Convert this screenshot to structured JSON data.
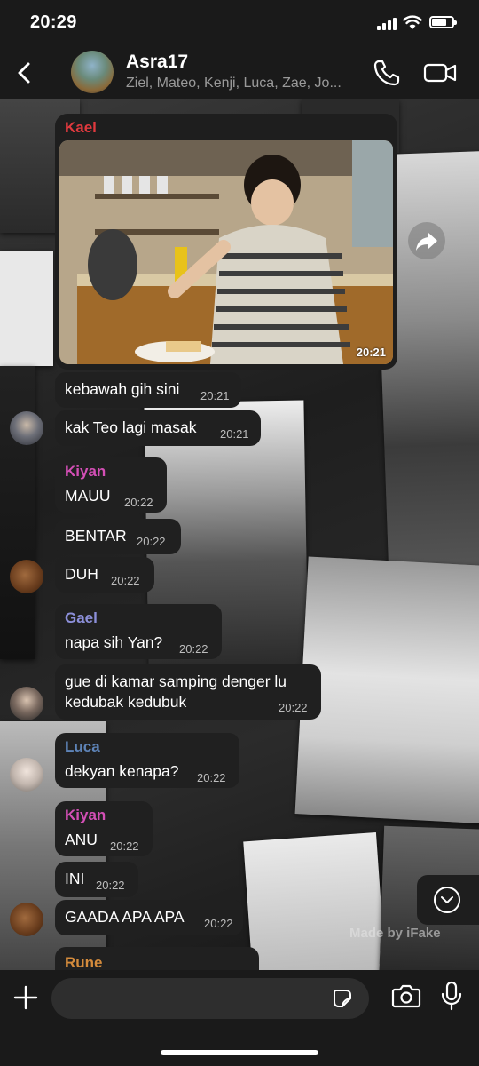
{
  "status_bar": {
    "time": "20:29"
  },
  "header": {
    "title": "Asra17",
    "subtitle": "Ziel, Mateo, Kenji, Luca, Zae, Jo..."
  },
  "colors": {
    "kael": "#e0393e",
    "kiyan": "#d44fb6",
    "gael": "#8c8fd9",
    "luca": "#5e84b8",
    "rune": "#d48b3c",
    "bubble": "#202020"
  },
  "messages": {
    "m1": {
      "sender": "Kael",
      "type": "image",
      "time": "20:21"
    },
    "m2": {
      "text": "kebawah gih sini",
      "time": "20:21"
    },
    "m3": {
      "text": "kak Teo lagi masak",
      "time": "20:21"
    },
    "m4": {
      "sender": "Kiyan",
      "text": "MAUU",
      "time": "20:22"
    },
    "m5": {
      "text": "BENTAR",
      "time": "20:22"
    },
    "m6": {
      "text": "DUH",
      "time": "20:22"
    },
    "m7": {
      "sender": "Gael",
      "text": "napa sih Yan?",
      "time": "20:22"
    },
    "m8": {
      "line1": "gue di kamar samping denger lu",
      "line2": "kedubak kedubuk",
      "time": "20:22"
    },
    "m9": {
      "sender": "Luca",
      "text": "dekyan kenapa?",
      "time": "20:22"
    },
    "m10": {
      "sender": "Kiyan",
      "text": "ANU",
      "time": "20:22"
    },
    "m11": {
      "text": "INI",
      "time": "20:22"
    },
    "m12": {
      "text": "GAADA APA APA",
      "time": "20:22"
    },
    "m13": {
      "sender": "Rune"
    }
  },
  "watermark": "Made by iFake",
  "icons": {
    "back": "chevron-left-icon",
    "phone": "phone-icon",
    "video": "video-camera-icon",
    "forward": "forward-arrow-icon",
    "scroll_down": "chevron-down-circle-icon",
    "plus": "plus-icon",
    "sticker": "sticker-icon",
    "camera": "camera-icon",
    "mic": "microphone-icon"
  }
}
